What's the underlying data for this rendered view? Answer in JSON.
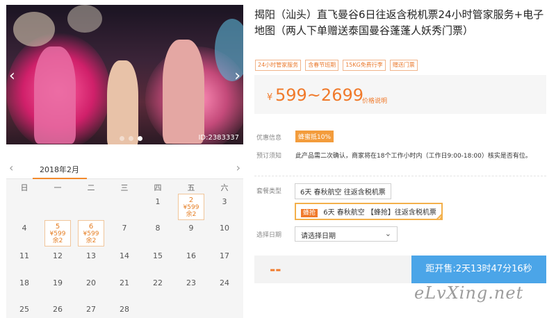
{
  "gallery": {
    "photo_id": "ID:2383337",
    "dots": 3,
    "active_dot": 2
  },
  "calendar": {
    "month": "2018年2月",
    "weekdays": [
      "日",
      "一",
      "二",
      "三",
      "四",
      "五",
      "六"
    ],
    "rows": [
      [
        "",
        "",
        "",
        "",
        "1",
        "2",
        "3"
      ],
      [
        "4",
        "5",
        "6",
        "7",
        "8",
        "9",
        "10"
      ],
      [
        "11",
        "12",
        "13",
        "14",
        "15",
        "16",
        "17"
      ],
      [
        "18",
        "19",
        "20",
        "21",
        "22",
        "23",
        "24"
      ],
      [
        "25",
        "26",
        "27",
        "28",
        "",
        "",
        ""
      ]
    ],
    "available": {
      "2": {
        "price": "¥599",
        "remain": "余2"
      },
      "5": {
        "price": "¥599",
        "remain": "余2"
      },
      "6": {
        "price": "¥599",
        "remain": "余2"
      }
    }
  },
  "product": {
    "title": "揭阳（汕头）直飞曼谷6日往返含税机票24小时管家服务+电子地图（两人下单赠送泰国曼谷蓬蓬人妖秀门票）",
    "tags": [
      "24小时管家服务",
      "含春节班期",
      "15KG免费行李",
      "赠送门票"
    ],
    "price_currency": "¥",
    "price": "599~2699",
    "price_note": "价格说明"
  },
  "info": {
    "discount_label": "优惠信息",
    "discount_badge": "蜂蜜抵10%",
    "booking_label": "预订须知",
    "booking_text": "此产品需二次确认，商家将在18个工作小时内（工作日9:00-18:00）核实是否有位。",
    "package_label": "套餐类型",
    "package_1": "6天 春秋航空 往返含税机票",
    "package_2_badge": "蜂抢",
    "package_2": "6天 春秋航空 【蜂抢】往返含税机票",
    "date_label": "选择日期",
    "date_placeholder": "请选择日期"
  },
  "buy": {
    "price_placeholder": "--",
    "countdown": "距开售:2天13时47分16秒"
  },
  "watermark": "eLvXing.net",
  "colors": {
    "accent": "#f07a2b",
    "button": "#4ba5e8"
  }
}
